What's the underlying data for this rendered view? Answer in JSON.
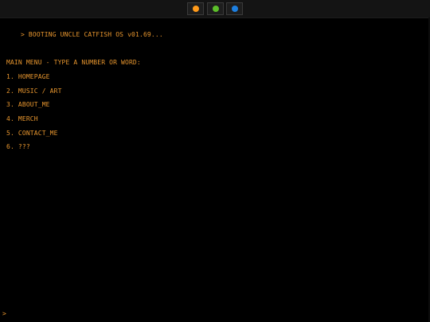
{
  "tabs": [
    {
      "icon": "orange-circle-icon",
      "color": "#ff9a1a"
    },
    {
      "icon": "green-circle-icon",
      "color": "#5cbf2a"
    },
    {
      "icon": "blue-circle-icon",
      "color": "#1d7fe0"
    }
  ],
  "terminal": {
    "boot_line": "> BOOTING UNCLE CATFISH OS v01.69...",
    "menu_title": "MAIN MENU - TYPE A NUMBER OR WORD:",
    "menu_items": [
      "1. HOMEPAGE",
      "2. MUSIC / ART",
      "3. ABOUT_ME",
      "4. MERCH",
      "5. CONTACT_ME",
      "6. ???"
    ],
    "prompt": ">",
    "input_value": ""
  },
  "colors": {
    "text": "#e8962e",
    "background": "#000000",
    "topbar": "#141414"
  }
}
